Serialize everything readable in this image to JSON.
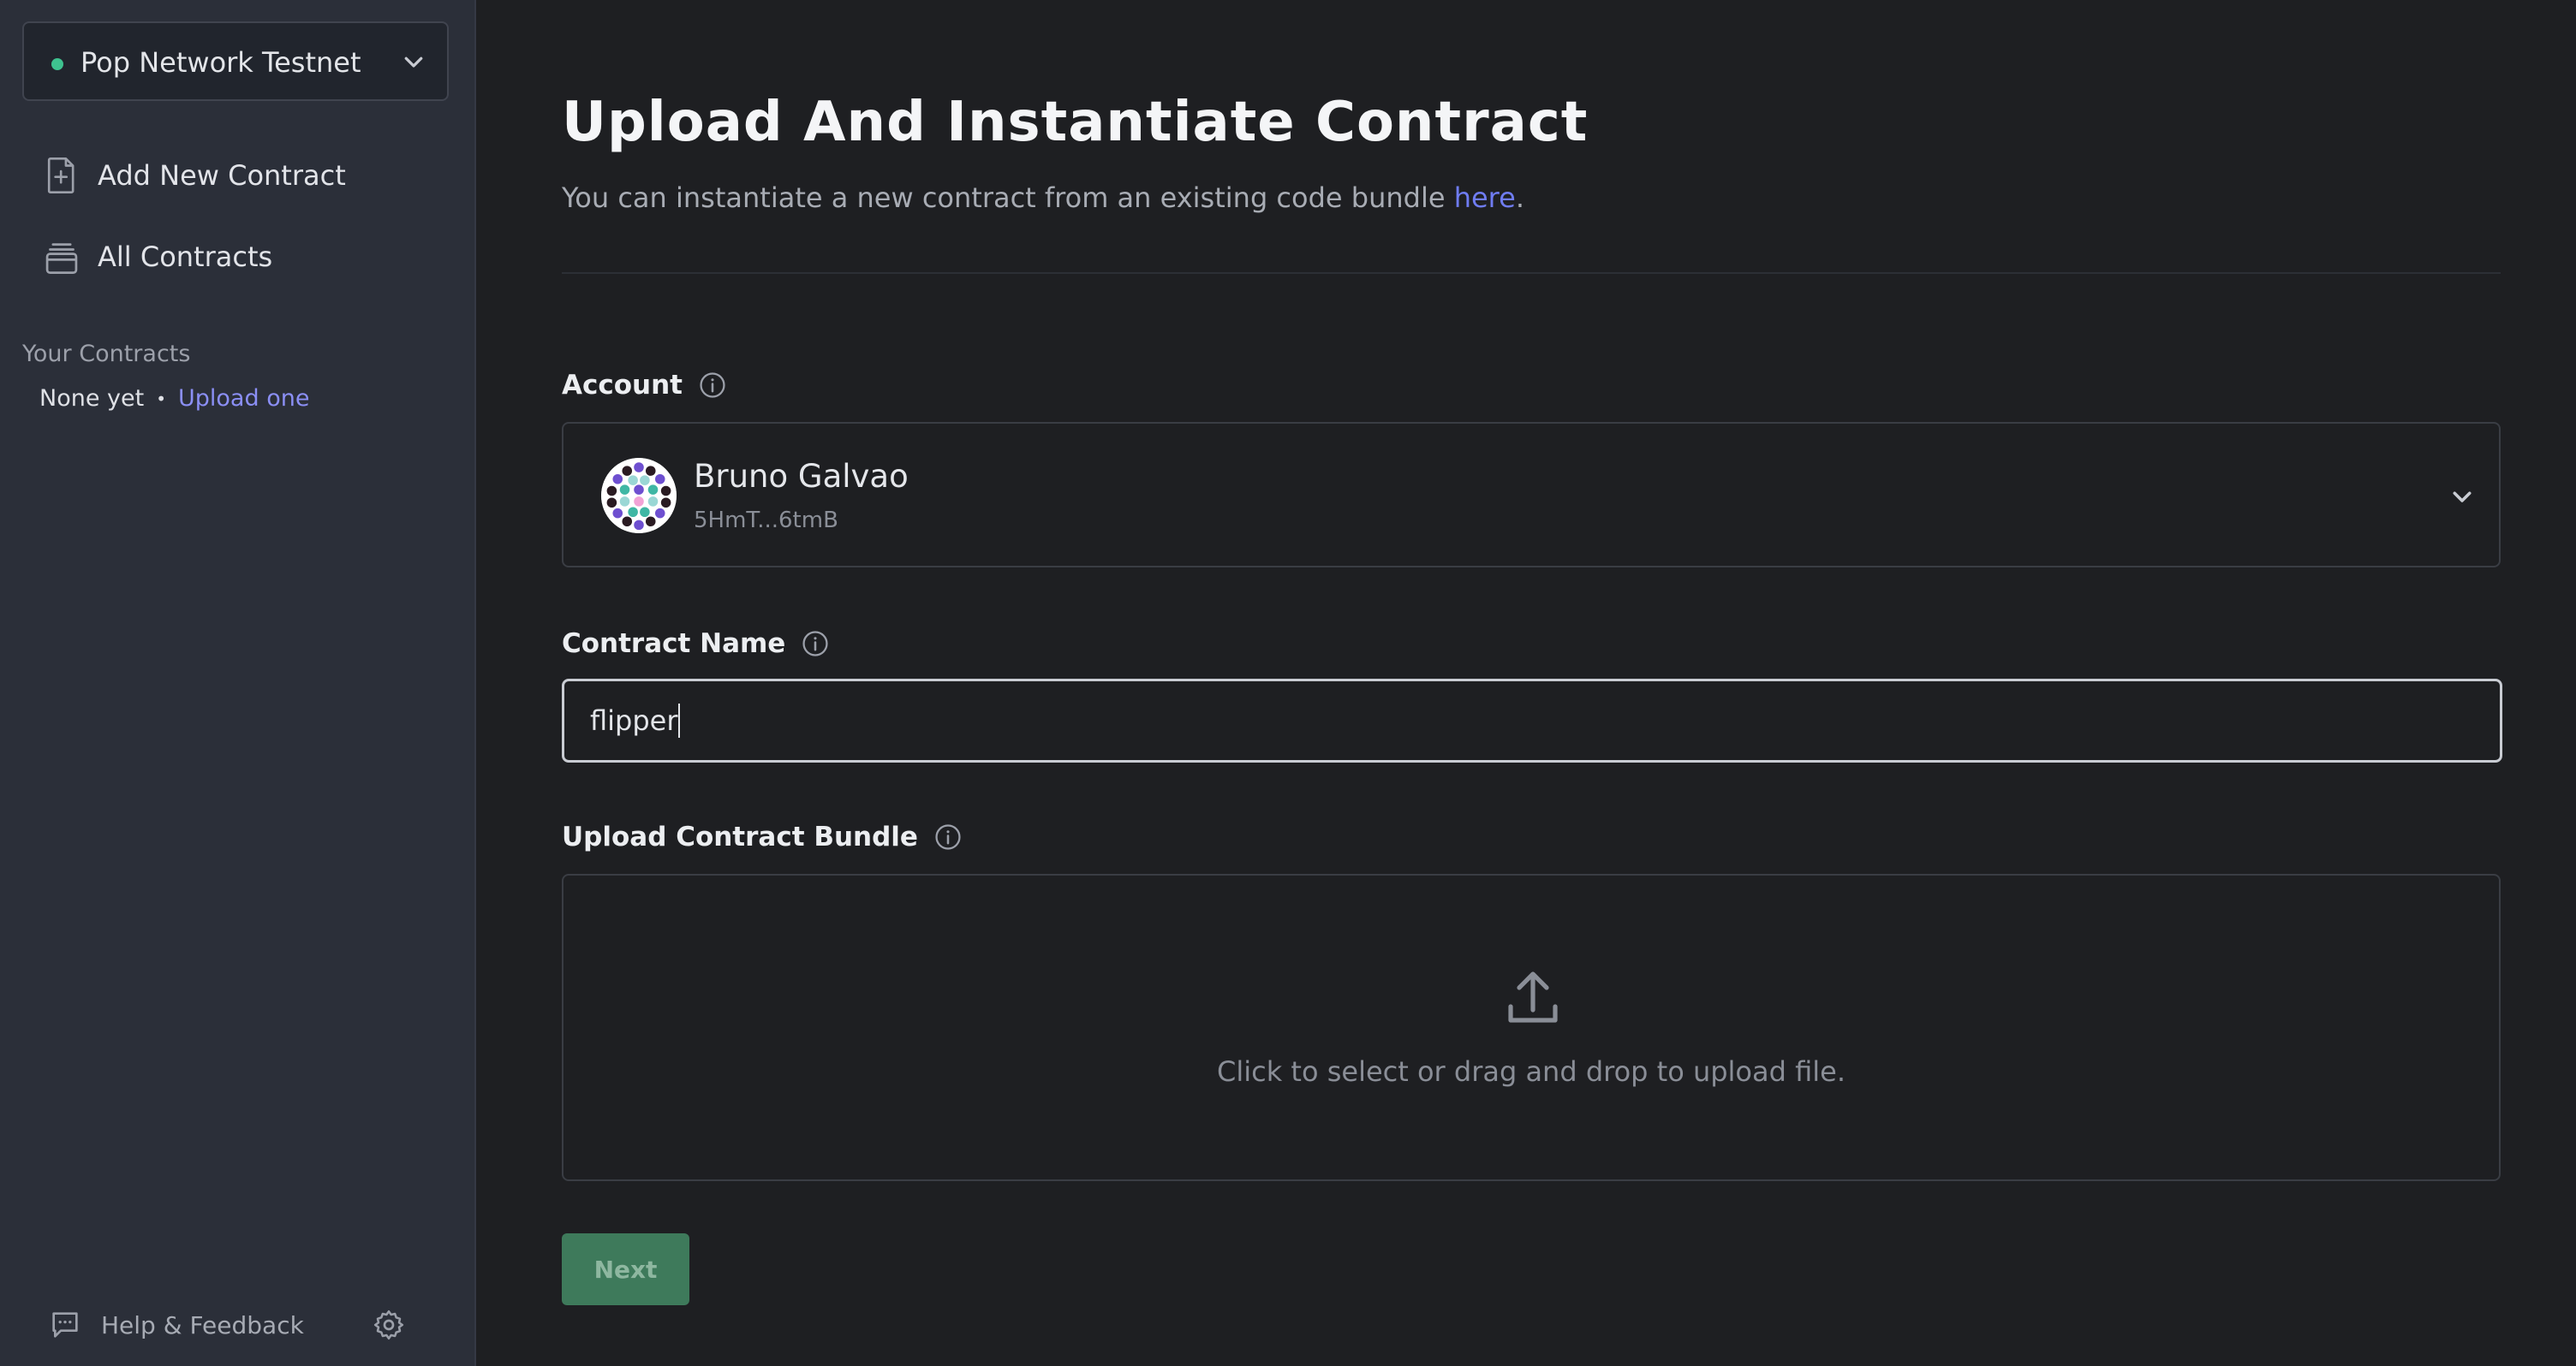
{
  "sidebar": {
    "network": {
      "label": "Pop Network Testnet",
      "status_color": "#3ec28f"
    },
    "nav": [
      {
        "label": "Add New Contract",
        "icon": "file-plus-icon"
      },
      {
        "label": "All Contracts",
        "icon": "stack-icon"
      }
    ],
    "your_contracts": {
      "title": "Your Contracts",
      "empty_text": "None yet",
      "separator": "•",
      "upload_link": "Upload one"
    },
    "help_label": "Help & Feedback"
  },
  "main": {
    "title": "Upload And Instantiate Contract",
    "subtitle_text": "You can instantiate a new contract from an existing code bundle ",
    "subtitle_link": "here",
    "subtitle_end": ".",
    "account": {
      "label": "Account",
      "name": "Bruno Galvao",
      "address": "5HmT...6tmB"
    },
    "contract_name": {
      "label": "Contract Name",
      "value": "flipper"
    },
    "bundle": {
      "label": "Upload Contract Bundle",
      "hint": "Click to select or drag and drop to upload file."
    },
    "next_label": "Next"
  },
  "colors": {
    "accent_link": "#6f7cf2",
    "sidebar_link": "#8b8ff5",
    "primary_button": "#3e7a5b"
  }
}
